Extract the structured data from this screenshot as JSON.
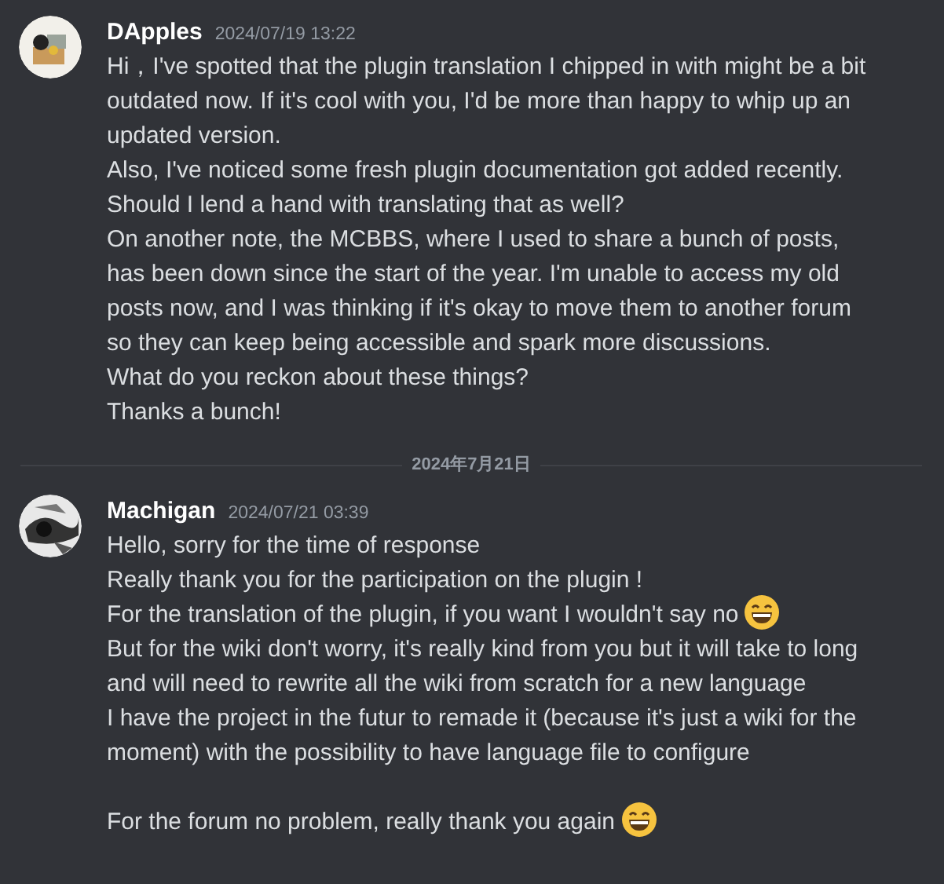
{
  "messages": [
    {
      "author": "DApples",
      "timestamp": "2024/07/19 13:22",
      "lines": [
        {
          "text": "Hi，I've spotted that the plugin translation I chipped in with might be a bit outdated now. If it's cool with you, I'd be more than happy to whip up an updated version."
        },
        {
          "text": "Also, I've noticed some fresh plugin documentation got added recently. Should I lend a hand with translating that as well?"
        },
        {
          "text": "On another note, the MCBBS, where I used to share a bunch of posts, has been down since the start of the year. I'm unable to access my old posts now, and I was thinking if it's okay to move them to another forum so they can keep being accessible and spark more discussions."
        },
        {
          "text": "What do you reckon about these things?"
        },
        {
          "text": "Thanks a bunch!"
        }
      ]
    },
    {
      "divider": "2024年7月21日",
      "author": "Machigan",
      "timestamp": "2024/07/21 03:39",
      "lines": [
        {
          "text": "Hello, sorry for the time of response"
        },
        {
          "text": "Really thank you for the participation on the plugin !"
        },
        {
          "text": "For the translation of the plugin, if you want I wouldn't say no",
          "emoji": true
        },
        {
          "text": "But for the wiki don't worry, it's really kind from you but it will take to long and will need to rewrite all the wiki from scratch for a new language"
        },
        {
          "text": "I have the project in the futur to remade it (because it's just a wiki for the moment) with the possibility to have language file to configure"
        },
        {
          "text": "For the forum no problem, really thank you again",
          "emoji": true,
          "spaced": true
        }
      ]
    }
  ]
}
